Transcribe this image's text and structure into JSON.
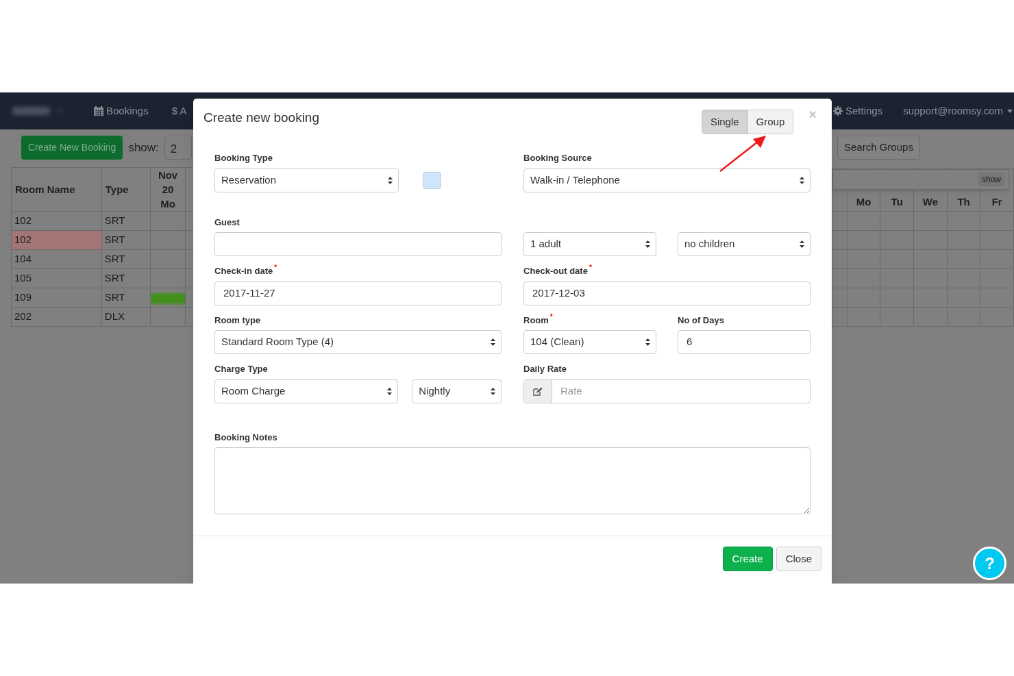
{
  "navbar": {
    "items": [
      {
        "kind": "calendar",
        "label": "Bookings"
      },
      {
        "kind": "plain",
        "label": "$ A"
      }
    ],
    "right_items": [
      {
        "kind": "gear",
        "label": "Settings"
      },
      {
        "kind": "dropdown",
        "label": "support@roomsy.com"
      }
    ]
  },
  "toolbar": {
    "create_button": "Create New Booking",
    "show_label": "show:",
    "show_value": "2",
    "search_groups_button": "Search Groups"
  },
  "popover": {
    "button": "show"
  },
  "left_table": {
    "columns": [
      "Room Name",
      "Type",
      "Nov\n20\nMo"
    ],
    "rows": [
      {
        "room": "102",
        "type": "SRT",
        "highlighted": false,
        "has_booking": false
      },
      {
        "room": "102",
        "type": "SRT",
        "highlighted": true,
        "has_booking": false
      },
      {
        "room": "104",
        "type": "SRT",
        "highlighted": false,
        "has_booking": false
      },
      {
        "room": "105",
        "type": "SRT",
        "highlighted": false,
        "has_booking": false
      },
      {
        "room": "109",
        "type": "SRT",
        "highlighted": false,
        "has_booking": true
      },
      {
        "room": "202",
        "type": "DLX",
        "highlighted": false,
        "has_booking": false
      }
    ]
  },
  "right_table": {
    "columns": [
      "Mo",
      "Tu",
      "We",
      "Th",
      "Fr"
    ]
  },
  "modal": {
    "title": "Create new booking",
    "mode_toggle": [
      {
        "label": "Single",
        "selected": true
      },
      {
        "label": "Group",
        "selected": false
      }
    ],
    "close": "×",
    "booking_type": {
      "label": "Booking Type",
      "value": "Reservation",
      "color": "#cfe6fb"
    },
    "booking_source": {
      "label": "Booking Source",
      "value": "Walk-in / Telephone"
    },
    "guest": {
      "label": "Guest"
    },
    "adults": {
      "value": "1 adult"
    },
    "children": {
      "value": "no children"
    },
    "check_in": {
      "label": "Check-in date",
      "required_mark": "*",
      "value": "2017-11-27"
    },
    "check_out": {
      "label": "Check-out date",
      "required_mark": "*",
      "value": "2017-12-03"
    },
    "room_type": {
      "label": "Room type",
      "value": "Standard Room Type (4)"
    },
    "room": {
      "label": "Room",
      "required_mark": "*",
      "value": "104 (Clean)"
    },
    "days": {
      "label": "No of Days",
      "value": "6"
    },
    "charge_type": {
      "label": "Charge Type",
      "value": "Room Charge"
    },
    "charge_period": {
      "value": "Nightly"
    },
    "daily_rate": {
      "label": "Daily Rate",
      "placeholder": "Rate"
    },
    "notes": {
      "label": "Booking Notes"
    },
    "buttons": [
      {
        "kind": "primary",
        "label": "Create"
      },
      {
        "kind": "default",
        "label": "Close"
      }
    ]
  },
  "help_button": "?"
}
